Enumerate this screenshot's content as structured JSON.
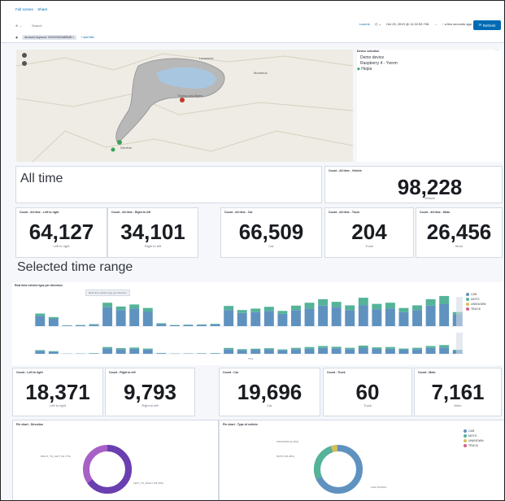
{
  "breadcrumbs": [
    "Full screen",
    "Share"
  ],
  "search": {
    "placeholder": "Search"
  },
  "query_bar": {
    "language": "Lucene",
    "time_range": "Oct 25, 2019 @ 11:32:53.708",
    "to": "→",
    "end": "~ a few seconds ago",
    "refresh_label": "Refresh"
  },
  "filter": {
    "pill": "deviceId.keyword: 000000000b8f5d8f ×",
    "add_filter": "+ Add filter"
  },
  "map": {
    "place_labels": [
      "Lausanne",
      "Montreux",
      "Thonon-les-Bains",
      "Genève"
    ]
  },
  "device_selection": {
    "title": "Device selection",
    "items": [
      {
        "label": "Demo device",
        "color": ""
      },
      {
        "label": "Raspberry 4 - Yverm",
        "color": ""
      },
      {
        "label": "Hepia",
        "color": "#3aa35c"
      }
    ]
  },
  "all_time": {
    "heading": "All time",
    "vehicle": {
      "title": "Count - All time - Vehicle",
      "value": "98,228",
      "label": "Vehicle"
    },
    "ltr": {
      "title": "Count - All time - Left to right",
      "value": "64,127",
      "label": "Left to right"
    },
    "rtl": {
      "title": "Count - All time - Right to left",
      "value": "34,101",
      "label": "Right to left"
    },
    "car": {
      "title": "Count - All time - Car",
      "value": "66,509",
      "label": "Car"
    },
    "truck": {
      "title": "Count - All time - Truck",
      "value": "204",
      "label": "Truck"
    },
    "moto": {
      "title": "Count - All time - Moto",
      "value": "26,456",
      "label": "Moto"
    }
  },
  "selected": {
    "heading": "Selected time range",
    "chart_title": "Real time vehicle type per direction",
    "chart_tooltip": "Real time vehicle type per direction",
    "legend": [
      {
        "label": "CAR",
        "color": "#6092c0"
      },
      {
        "label": "MOTO",
        "color": "#54b399"
      },
      {
        "label": "UNKNOWN",
        "color": "#d6bf57"
      },
      {
        "label": "TRUCK",
        "color": "#d36086"
      }
    ],
    "x_axis_label": "Time",
    "ltr": {
      "title": "Count - Left to right",
      "value": "18,371",
      "label": "Left to right"
    },
    "rtl": {
      "title": "Count - Right to left",
      "value": "9,793",
      "label": "Right to left"
    },
    "car": {
      "title": "Count - Car",
      "value": "19,696",
      "label": "Car"
    },
    "truck": {
      "title": "Count - Truck",
      "value": "60",
      "label": "Truck"
    },
    "moto": {
      "title": "Count - Moto",
      "value": "7,161",
      "label": "Moto"
    },
    "pie_direction": {
      "title": "Pie chart - Direction",
      "label_a": "RIGHT_TO_LEFT (34.77%)",
      "label_b": "LEFT_TO_RIGHT (65.23%)",
      "color_a": "#a760c6",
      "color_b": "#6a3fb0"
    },
    "pie_vehicle": {
      "title": "Pie chart - Type of vehicle",
      "label_a": "UNKNOWN (4.26%)",
      "label_b": "MOTO (26.48%)",
      "label_c": "CAR (69.06%)",
      "legend": [
        "CAR",
        "MOTO",
        "UNKNOWN",
        "TRUCK"
      ]
    }
  },
  "chart_data": {
    "type": "bar",
    "title": "Real time vehicle type per direction",
    "x_axis_label": "Time",
    "series": [
      {
        "name": "CAR",
        "values": [
          35,
          25,
          2,
          3,
          5,
          65,
          55,
          60,
          50,
          8,
          3,
          4,
          5,
          6,
          55,
          45,
          48,
          52,
          42,
          55,
          60,
          70,
          65,
          55,
          72,
          58,
          60,
          48,
          55,
          70,
          75,
          40
        ]
      },
      {
        "name": "MOTO",
        "values": [
          8,
          6,
          1,
          1,
          2,
          15,
          12,
          14,
          12,
          2,
          1,
          1,
          1,
          2,
          14,
          10,
          12,
          14,
          10,
          15,
          20,
          22,
          18,
          16,
          25,
          18,
          20,
          14,
          16,
          22,
          28,
          8
        ]
      }
    ]
  }
}
